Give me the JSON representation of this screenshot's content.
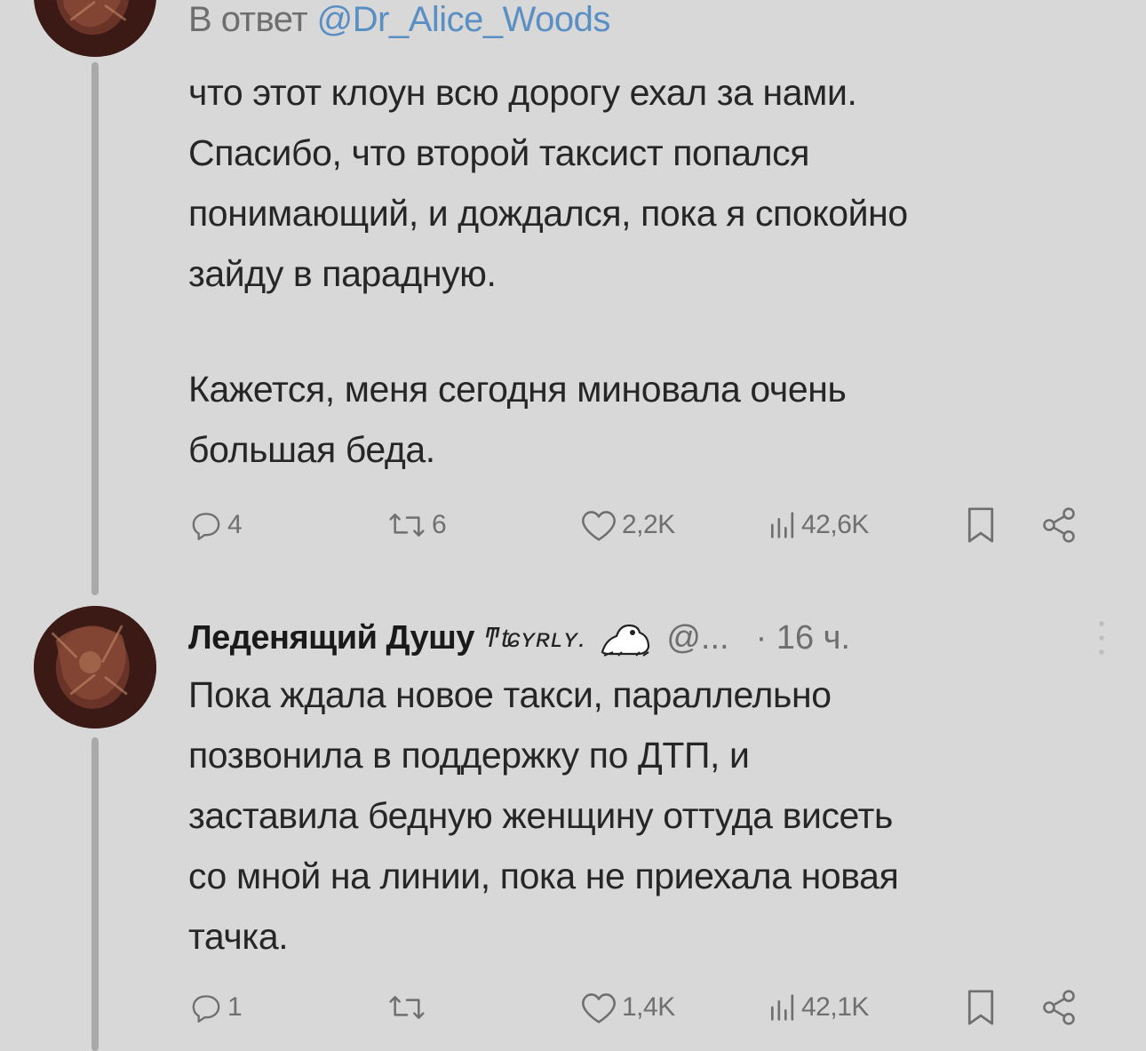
{
  "tweet1": {
    "reply_prefix": "В ответ ",
    "reply_mention": "@Dr_Alice_Woods",
    "text_para1": "что этот клоун всю дорогу ехал за нами.\nСпасибо, что второй таксист попался\nпонимающий, и дождался, пока я спокойно\nзайду в парадную.",
    "text_para2": "Кажется, меня сегодня миновала очень\nбольшая беда.",
    "actions": {
      "replies": "4",
      "retweets": "6",
      "likes": "2,2K",
      "views": "42,6K"
    }
  },
  "tweet2": {
    "author_name": "Леденящий Душу",
    "author_name_deco": "ͳʨʏʀʟʏ.",
    "handle": "@...",
    "time": "· 16 ч.",
    "text": "Пока ждала новое такси, параллельно\nпозвонила в поддержку по ДТП, и\nзаставила бедную женщину оттуда висеть\nсо мной на линии, пока не приехала новая\nтачка.",
    "actions": {
      "replies": "1",
      "retweets": "",
      "likes": "1,4K",
      "views": "42,1K"
    }
  },
  "icons": [
    "avatar",
    "reply-icon",
    "retweet-icon",
    "like-icon",
    "views-icon",
    "bookmark-icon",
    "share-icon",
    "more-icon",
    "frog-emoji-icon"
  ],
  "colors": {
    "background": "#d8d8d8",
    "text": "#262626",
    "muted": "#6e6e6e",
    "mention": "#5a8fc4",
    "thread_line": "#a9a9a9"
  }
}
